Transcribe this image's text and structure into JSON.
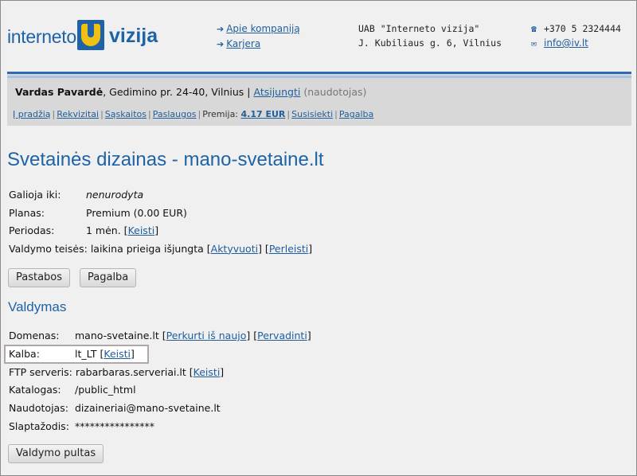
{
  "header": {
    "logo_word1": "interneto",
    "logo_word2": "vizija",
    "links": [
      {
        "label": "Apie kompaniją"
      },
      {
        "label": "Karjera"
      }
    ],
    "company_name": "UAB \"Interneto vizija\"",
    "company_address": "J. Kubiliaus g. 6, Vilnius",
    "phone": "+370 5 2324444",
    "email": "info@iv.lt"
  },
  "userbar": {
    "user_name": "Vardas Pavardė",
    "user_address": ", Gedimino pr. 24-40, Vilnius | ",
    "logout_label": "Atsijungti",
    "role": "(naudotojas)",
    "nav": {
      "home": "Į pradžią",
      "details": "Rekvizitai",
      "invoices": "Sąskaitos",
      "services": "Paslaugos",
      "bonus_label": "Premija: ",
      "bonus_value": "4.17 EUR",
      "contact": "Susisiekti",
      "help": "Pagalba"
    }
  },
  "page": {
    "title": "Svetainės dizainas - mano-svetaine.lt",
    "info": {
      "valid_label": "Galioja iki:",
      "valid_value": "nenurodyta",
      "plan_label": "Planas:",
      "plan_value": "Premium (0.00 EUR)",
      "period_label": "Periodas:",
      "period_value": "1 mėn.",
      "change_label": "Keisti",
      "rights_label": "Valdymo teisės:",
      "rights_value": "laikina prieiga išjungta",
      "activate_label": "Aktyvuoti",
      "transfer_label": "Perleisti"
    },
    "buttons": {
      "notes": "Pastabos",
      "help": "Pagalba",
      "control_panel": "Valdymo pultas"
    },
    "section_title": "Valdymas",
    "management": {
      "domain_label": "Domenas:",
      "domain_value": "mano-svetaine.lt",
      "recreate_label": "Perkurti iš naujo",
      "rename_label": "Pervadinti",
      "language_label": "Kalba:",
      "language_value": "lt_LT",
      "language_change": "Keisti",
      "ftp_label": "FTP serveris:",
      "ftp_value": "rabarbaras.serveriai.lt",
      "ftp_change": "Keisti",
      "dir_label": "Katalogas:",
      "dir_value": "/public_html",
      "user_label": "Naudotojas:",
      "user_value": "dizaineriai@mano-svetaine.lt",
      "password_label": "Slaptažodis:",
      "password_value": "****************"
    }
  },
  "colors": {
    "accent": "#1e63a6",
    "logo_yellow": "#f2c010",
    "bar_bg": "#d8d8d8"
  }
}
